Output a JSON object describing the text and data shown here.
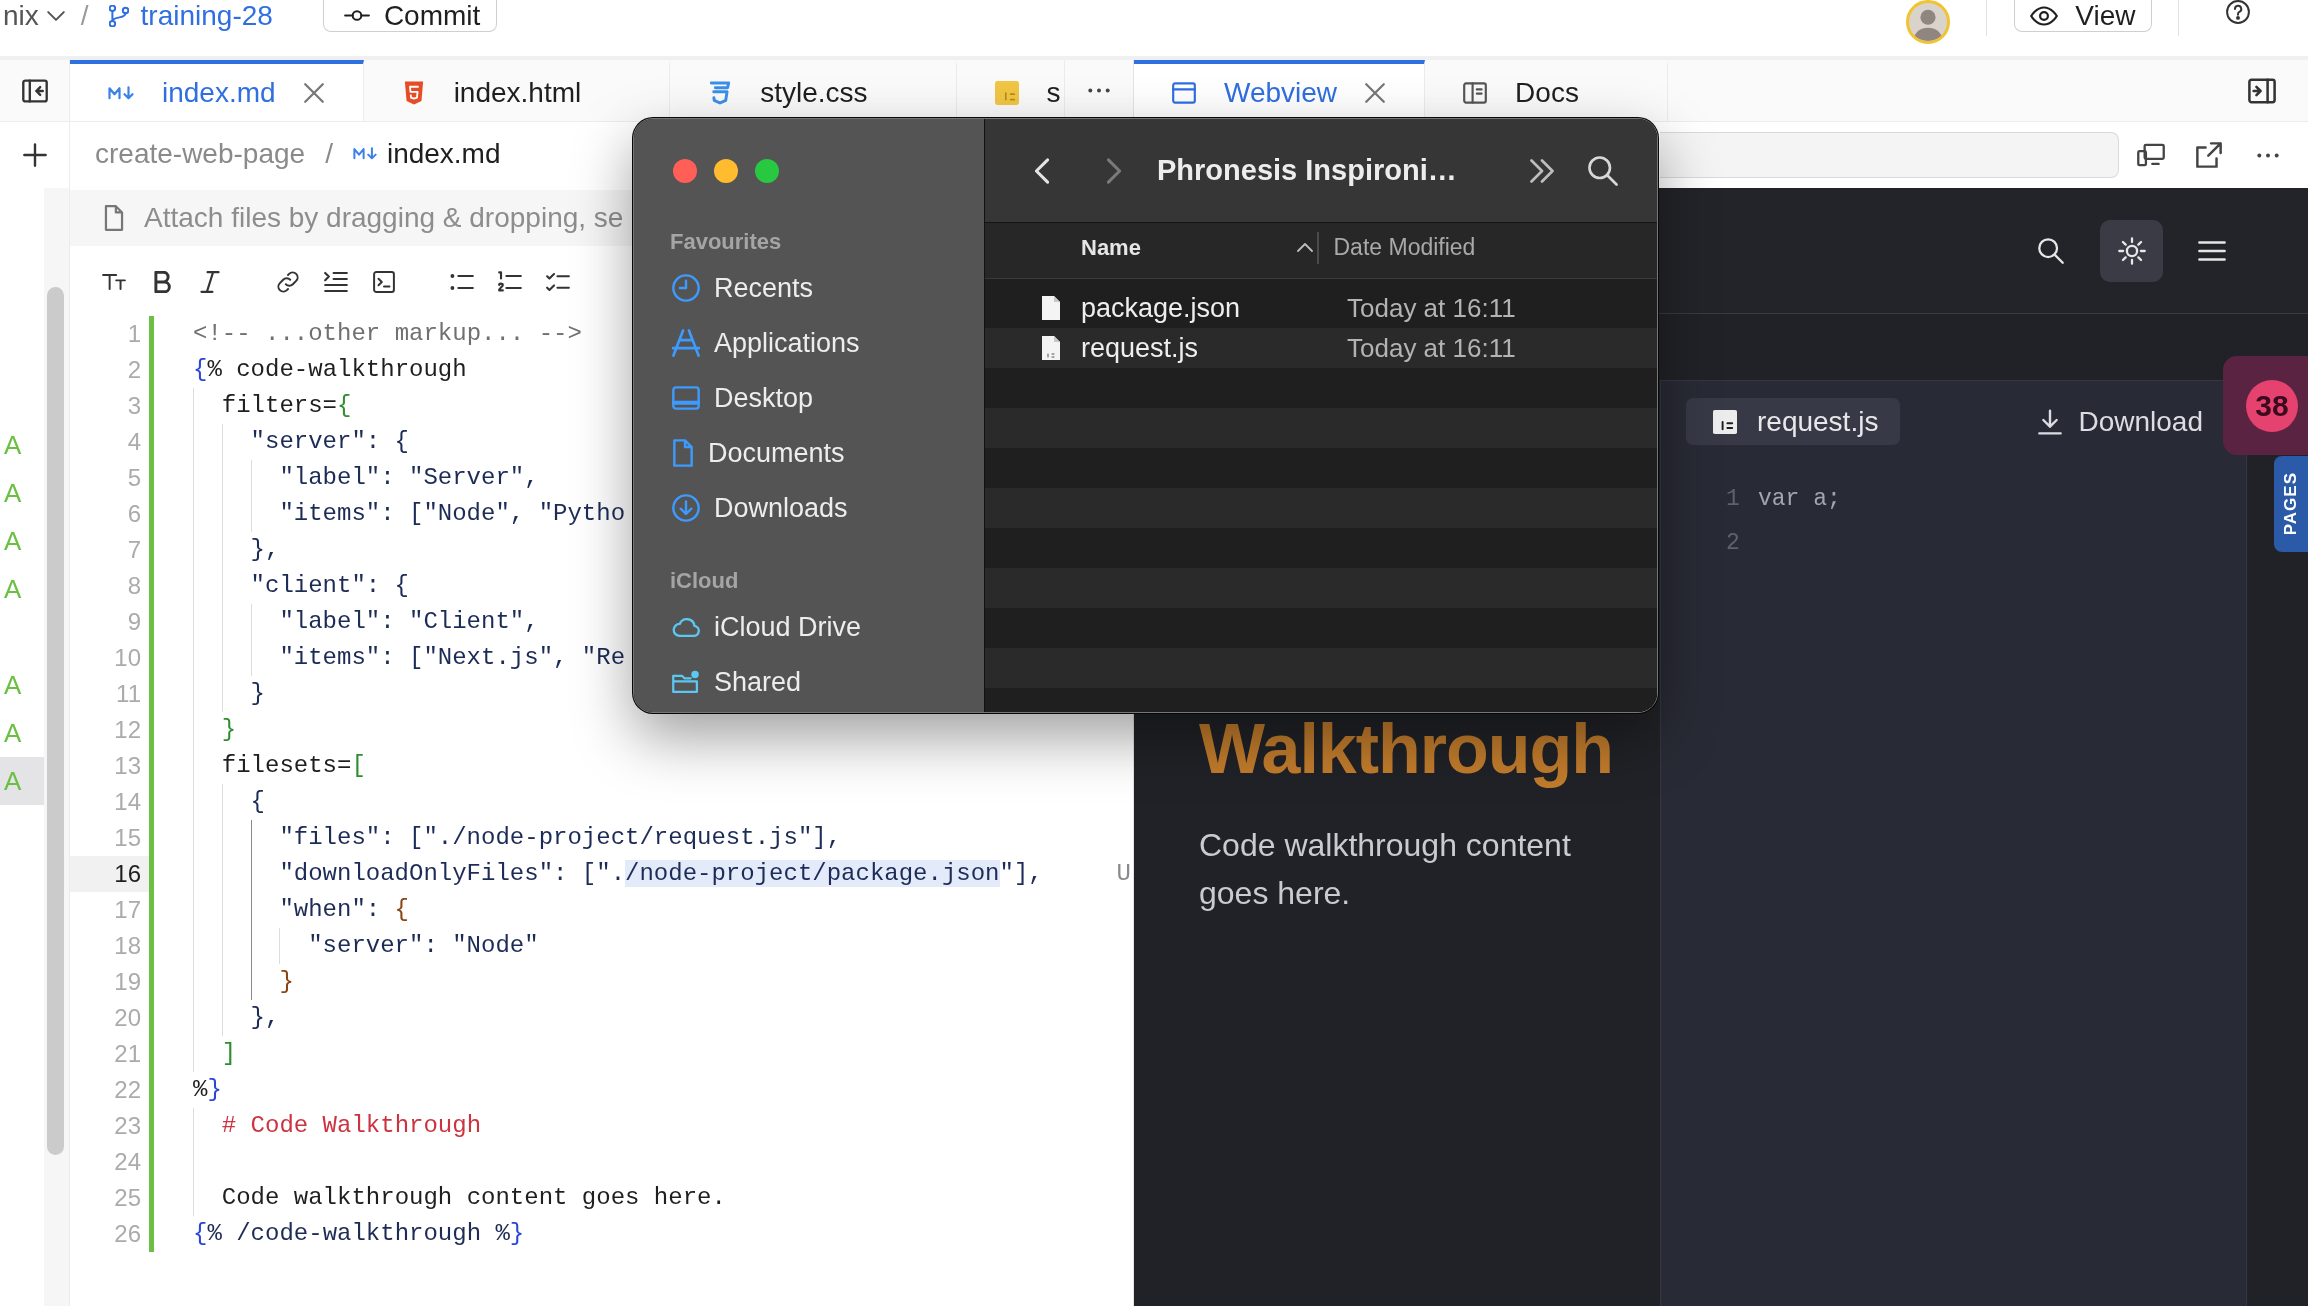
{
  "top_bar": {
    "workspace": "nix",
    "separator": "/",
    "branch": "training-28",
    "commit_button": "Commit",
    "view_button": "View"
  },
  "change_list": [
    {
      "label": "A",
      "selected": false
    },
    {
      "label": "A",
      "selected": false
    },
    {
      "label": "A",
      "selected": false
    },
    {
      "label": "A",
      "selected": false
    },
    {
      "selected": false
    },
    {
      "label": "A",
      "selected": false
    },
    {
      "label": "A",
      "selected": false
    },
    {
      "label": "A",
      "selected": true
    }
  ],
  "editor": {
    "tabs": [
      {
        "label": "index.md",
        "kind": "markdown",
        "selected": true
      },
      {
        "label": "index.html",
        "kind": "html",
        "selected": false
      },
      {
        "label": "style.css",
        "kind": "css",
        "selected": false
      },
      {
        "label": "s",
        "kind": "javascript",
        "selected": false
      }
    ],
    "breadcrumb": {
      "folder": "create-web-page",
      "separator": "/",
      "file": "index.md"
    },
    "attach_hint": "Attach files by dragging & dropping, se",
    "lines": [
      {
        "number": "1",
        "added": true,
        "current": false,
        "segments": [
          {
            "text": "<!-- ...other markup... -->",
            "kind": "comment"
          }
        ]
      },
      {
        "number": "2",
        "added": true,
        "current": false,
        "segments": [
          {
            "text": "{",
            "kind": "tag"
          },
          {
            "text": "% code-walkthrough",
            "kind": "text"
          }
        ]
      },
      {
        "number": "3",
        "added": true,
        "current": false,
        "guides": [
          {
            "active": false
          }
        ],
        "segments": [
          {
            "text": "filters=",
            "kind": "text"
          },
          {
            "text": "{",
            "kind": "green"
          }
        ]
      },
      {
        "number": "4",
        "added": true,
        "current": false,
        "guides": [
          {
            "active": false
          },
          {
            "active": false
          }
        ],
        "segments": [
          {
            "text": "\"server\": {",
            "kind": "string"
          }
        ]
      },
      {
        "number": "5",
        "added": true,
        "current": false,
        "guides": [
          {
            "active": false
          },
          {
            "active": false
          },
          {
            "active": false
          }
        ],
        "segments": [
          {
            "text": "\"label\": \"Server\",",
            "kind": "string"
          }
        ]
      },
      {
        "number": "6",
        "added": true,
        "current": false,
        "guides": [
          {
            "active": false
          },
          {
            "active": false
          },
          {
            "active": false
          }
        ],
        "segments": [
          {
            "text": "\"items\": [\"Node\", \"Pytho",
            "kind": "string"
          }
        ]
      },
      {
        "number": "7",
        "added": true,
        "current": false,
        "guides": [
          {
            "active": false
          },
          {
            "active": false
          }
        ],
        "segments": [
          {
            "text": "},",
            "kind": "string"
          }
        ]
      },
      {
        "number": "8",
        "added": true,
        "current": false,
        "guides": [
          {
            "active": false
          },
          {
            "active": false
          }
        ],
        "segments": [
          {
            "text": "\"client\": {",
            "kind": "string"
          }
        ]
      },
      {
        "number": "9",
        "added": true,
        "current": false,
        "guides": [
          {
            "active": false
          },
          {
            "active": false
          },
          {
            "active": false
          }
        ],
        "segments": [
          {
            "text": "\"label\": \"Client\",",
            "kind": "string"
          }
        ]
      },
      {
        "number": "10",
        "added": true,
        "current": false,
        "guides": [
          {
            "active": false
          },
          {
            "active": false
          },
          {
            "active": false
          }
        ],
        "segments": [
          {
            "text": "\"items\": [\"Next.js\", \"Re",
            "kind": "string"
          }
        ]
      },
      {
        "number": "11",
        "added": true,
        "current": false,
        "guides": [
          {
            "active": false
          },
          {
            "active": false
          }
        ],
        "segments": [
          {
            "text": "}",
            "kind": "string"
          }
        ]
      },
      {
        "number": "12",
        "added": true,
        "current": false,
        "guides": [
          {
            "active": false
          }
        ],
        "segments": [
          {
            "text": "}",
            "kind": "green"
          }
        ]
      },
      {
        "number": "13",
        "added": true,
        "current": false,
        "guides": [
          {
            "active": false
          }
        ],
        "segments": [
          {
            "text": "filesets=",
            "kind": "text"
          },
          {
            "text": "[",
            "kind": "green"
          }
        ]
      },
      {
        "number": "14",
        "added": true,
        "current": false,
        "guides": [
          {
            "active": false
          },
          {
            "active": false
          }
        ],
        "segments": [
          {
            "text": "{",
            "kind": "string"
          }
        ]
      },
      {
        "number": "15",
        "added": true,
        "current": false,
        "guides": [
          {
            "active": false
          },
          {
            "active": false
          },
          {
            "active": true
          }
        ],
        "segments": [
          {
            "text": "\"files\": [\"./node-project/request.js\"],",
            "kind": "string"
          }
        ]
      },
      {
        "number": "16",
        "added": true,
        "current": true,
        "guides": [
          {
            "active": false
          },
          {
            "active": false
          },
          {
            "active": true
          }
        ],
        "segments": [
          {
            "text": "\"downloadOnlyFiles\": [\".",
            "kind": "string"
          },
          {
            "text": "/node-project/package.json",
            "kind": "match"
          },
          {
            "text": "\"],",
            "kind": "string"
          }
        ],
        "annotation": "U"
      },
      {
        "number": "17",
        "added": true,
        "current": false,
        "guides": [
          {
            "active": false
          },
          {
            "active": false
          },
          {
            "active": true
          }
        ],
        "segments": [
          {
            "text": "\"when\": ",
            "kind": "string"
          },
          {
            "text": "{",
            "kind": "brown"
          }
        ]
      },
      {
        "number": "18",
        "added": true,
        "current": false,
        "guides": [
          {
            "active": false
          },
          {
            "active": false
          },
          {
            "active": true
          },
          {
            "active": false
          }
        ],
        "segments": [
          {
            "text": "\"server\": \"Node\"",
            "kind": "string"
          }
        ]
      },
      {
        "number": "19",
        "added": true,
        "current": false,
        "guides": [
          {
            "active": false
          },
          {
            "active": false
          },
          {
            "active": true
          }
        ],
        "segments": [
          {
            "text": "}",
            "kind": "brown"
          }
        ]
      },
      {
        "number": "20",
        "added": true,
        "current": false,
        "guides": [
          {
            "active": false
          },
          {
            "active": false
          }
        ],
        "segments": [
          {
            "text": "},",
            "kind": "string"
          }
        ]
      },
      {
        "number": "21",
        "added": true,
        "current": false,
        "guides": [
          {
            "active": false
          }
        ],
        "segments": [
          {
            "text": "]",
            "kind": "green"
          }
        ]
      },
      {
        "number": "22",
        "added": true,
        "current": false,
        "segments": [
          {
            "text": "%",
            "kind": "text"
          },
          {
            "text": "}",
            "kind": "tag"
          }
        ]
      },
      {
        "number": "23",
        "added": true,
        "current": false,
        "guides": [
          {
            "active": false
          }
        ],
        "segments": [
          {
            "text": "# Code Walkthrough",
            "kind": "heading"
          }
        ]
      },
      {
        "number": "24",
        "added": true,
        "current": false,
        "guides": [
          {
            "active": false
          }
        ]
      },
      {
        "number": "25",
        "added": true,
        "current": false,
        "guides": [
          {
            "active": false
          }
        ],
        "segments": [
          {
            "text": "Code walkthrough content goes here.",
            "kind": "text"
          }
        ]
      },
      {
        "number": "26",
        "added": true,
        "current": false,
        "segments": [
          {
            "text": "{",
            "kind": "tag"
          },
          {
            "text": "% /code-walkthrough %",
            "kind": "string"
          },
          {
            "text": "}",
            "kind": "tag"
          }
        ]
      }
    ]
  },
  "webview": {
    "tabs": [
      {
        "label": "Webview",
        "kind": "preview",
        "selected": true
      },
      {
        "label": "Docs",
        "kind": "docs",
        "selected": false
      }
    ],
    "heading": "Walkthrough",
    "paragraph": "Code walkthrough content goes here.",
    "code_panel": {
      "file": "request.js",
      "download": "Download",
      "lines": [
        {
          "number": "1",
          "text": "var a;"
        },
        {
          "number": "2"
        }
      ]
    },
    "badge": "38",
    "side_tab": "PAGES"
  },
  "finder": {
    "nav": [
      {
        "kind": "back",
        "disabled": false
      },
      {
        "kind": "forward",
        "disabled": true
      }
    ],
    "title": "Phronesis Inspironi…",
    "sidebar": [
      {
        "heading": "Favourites",
        "items": [
          {
            "label": "Recents",
            "kind": "recents"
          },
          {
            "label": "Applications",
            "kind": "applications"
          },
          {
            "label": "Desktop",
            "kind": "desktop"
          },
          {
            "label": "Documents",
            "kind": "documents"
          },
          {
            "label": "Downloads",
            "kind": "downloads"
          }
        ]
      },
      {
        "heading": "iCloud",
        "items": [
          {
            "label": "iCloud Drive",
            "kind": "cloud"
          },
          {
            "label": "Shared",
            "kind": "shared"
          }
        ]
      }
    ],
    "columns": [
      {
        "label": "Name",
        "sorted": true
      },
      {
        "label": "Date Modified",
        "sorted": false
      }
    ],
    "files": [
      {
        "name": "package.json",
        "kind": "document",
        "modified": "Today at 16:11"
      },
      {
        "name": "request.js",
        "kind": "script",
        "modified": "Today at 16:11"
      }
    ]
  }
}
